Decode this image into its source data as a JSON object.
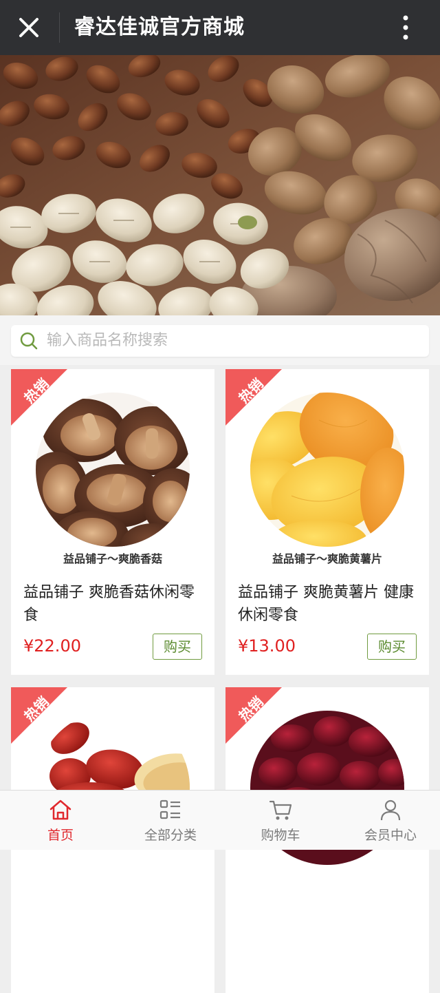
{
  "header": {
    "title": "睿达佳诚官方商城",
    "close_icon": "close-icon",
    "more_icon": "more-vertical-icon"
  },
  "banner": {
    "description_icon": "nuts-banner-image"
  },
  "search": {
    "placeholder": "输入商品名称搜索",
    "icon": "search-icon"
  },
  "products": [
    {
      "badge": "热销",
      "caption": "益品铺子～爽脆香菇",
      "name": "益品铺子 爽脆香菇休闲零食",
      "price": "¥22.00",
      "buy_label": "购买"
    },
    {
      "badge": "热销",
      "caption": "益品铺子～爽脆黄薯片",
      "name": "益品铺子 爽脆黄薯片 健康休闲零食",
      "price": "¥13.00",
      "buy_label": "购买"
    },
    {
      "badge": "热销"
    },
    {
      "badge": "热销"
    }
  ],
  "tabbar": {
    "items": [
      {
        "label": "首页",
        "icon": "home-icon",
        "active": true
      },
      {
        "label": "全部分类",
        "icon": "category-list-icon",
        "active": false
      },
      {
        "label": "购物车",
        "icon": "cart-icon",
        "active": false
      },
      {
        "label": "会员中心",
        "icon": "user-icon",
        "active": false
      }
    ]
  },
  "colors": {
    "header_bg": "#2f3033",
    "accent_red": "#e0282d",
    "badge_red": "#f05a5a",
    "buy_green": "#6f9a3e"
  }
}
